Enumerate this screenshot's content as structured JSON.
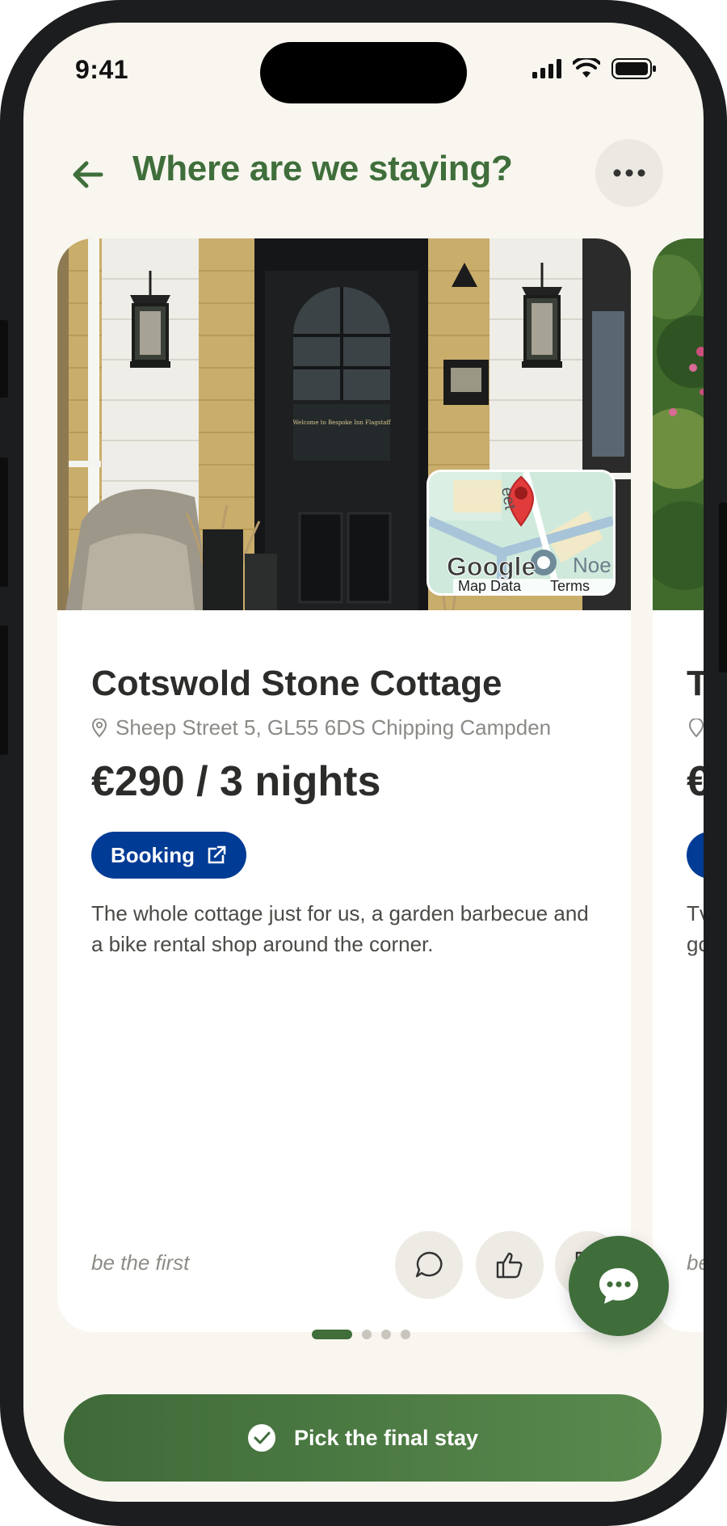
{
  "status_bar": {
    "time": "9:41"
  },
  "header": {
    "title": "Where are we staying?"
  },
  "icons": {
    "back": "arrow-left-icon",
    "more": "more-horizontal-icon",
    "location": "map-pin-icon",
    "external": "external-link-icon",
    "comment": "comment-icon",
    "like": "thumbs-up-icon",
    "dislike": "thumbs-down-icon",
    "chat": "chat-bubble-icon",
    "check": "check-circle-icon"
  },
  "colors": {
    "brand": "#3f6e3b",
    "booking": "#003b95",
    "background": "#f8f6ef"
  },
  "cards": [
    {
      "title": "Cotswold Stone Cottage",
      "address": "Sheep Street 5, GL55 6DS Chipping Campden",
      "price": "€290 / 3 nights",
      "booking_label": "Booking",
      "description": "The whole cottage just for us, a garden barbecue and a bike rental shop around the corner.",
      "reactions_label": "be the first",
      "map": {
        "brand": "Google",
        "data_label": "Map Data",
        "terms_label": "Terms",
        "street_fragment": "Noe",
        "road_fragment": "eet"
      },
      "door_sign": "Welcome to Bespoke Inn Flagstaff"
    },
    {
      "title_fragment": "T",
      "description_fragment_1": "Tv",
      "description_fragment_2": "gc",
      "reactions_fragment": "be"
    }
  ],
  "pagination": {
    "total": 4,
    "active": 0
  },
  "cta": {
    "label": "Pick the final stay"
  }
}
